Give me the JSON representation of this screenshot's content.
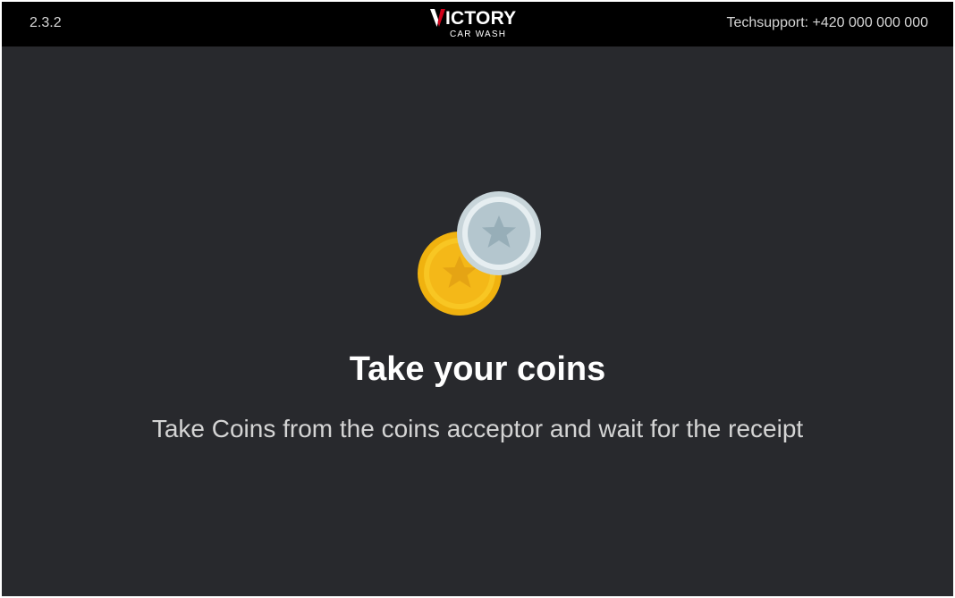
{
  "header": {
    "version": "2.3.2",
    "logo_text": "ICTORY",
    "logo_subtext": "CAR WASH",
    "techsupport": "Techsupport: +420 000 000 000"
  },
  "icons": {
    "gold_coin": "gold-coin-icon",
    "silver_coin": "silver-coin-icon"
  },
  "colors": {
    "background": "#28292d",
    "topbar": "#000000",
    "logo_accent": "#d0021b",
    "gold": "#f5c518",
    "silver": "#c9d6dc"
  },
  "main": {
    "title": "Take your coins",
    "message": "Take Coins from the coins acceptor and wait for the receipt"
  }
}
